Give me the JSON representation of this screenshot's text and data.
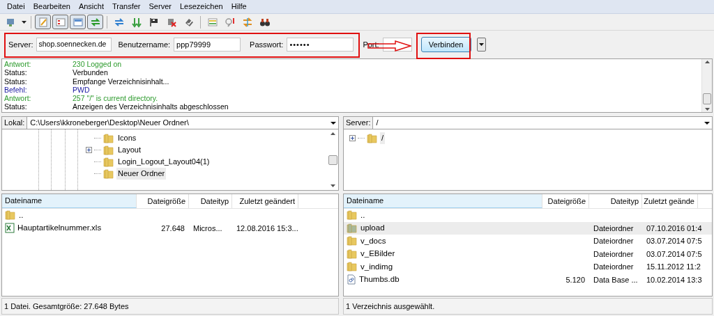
{
  "menu": [
    "Datei",
    "Bearbeiten",
    "Ansicht",
    "Transfer",
    "Server",
    "Lesezeichen",
    "Hilfe"
  ],
  "toolbar": [
    {
      "kind": "site",
      "pressed": false
    },
    {
      "kind": "log",
      "pressed": true
    },
    {
      "kind": "tree",
      "pressed": true
    },
    {
      "kind": "remote",
      "pressed": true
    },
    {
      "kind": "queue",
      "pressed": true
    },
    {
      "kind": "refresh",
      "pressed": false
    },
    {
      "kind": "process",
      "pressed": false
    },
    {
      "kind": "flag",
      "pressed": false
    },
    {
      "kind": "cancel",
      "pressed": false
    },
    {
      "kind": "disconnect",
      "pressed": false
    },
    {
      "kind": "filter",
      "pressed": false
    },
    {
      "kind": "compare",
      "pressed": false
    },
    {
      "kind": "sync",
      "pressed": false
    },
    {
      "kind": "find",
      "pressed": false
    }
  ],
  "quickconnect": {
    "server_label": "Server:",
    "server": "shop.soennecken.de",
    "user_label": "Benutzername:",
    "user": "ppp79999",
    "password_label": "Passwort:",
    "password": "••••••",
    "port_label": "Port:",
    "connect": "Verbinden"
  },
  "log": [
    {
      "kind": "response",
      "label": "Antwort:",
      "text": "230 Logged on"
    },
    {
      "kind": "status",
      "label": "Status:",
      "text": "Verbunden"
    },
    {
      "kind": "status",
      "label": "Status:",
      "text": "Empfange Verzeichnisinhalt..."
    },
    {
      "kind": "command",
      "label": "Befehl:",
      "text": "PWD"
    },
    {
      "kind": "response",
      "label": "Antwort:",
      "text": "257 \"/\" is current directory."
    },
    {
      "kind": "status",
      "label": "Status:",
      "text": "Anzeigen des Verzeichnisinhalts abgeschlossen"
    }
  ],
  "local": {
    "path_label": "Lokal:",
    "path": "C:\\Users\\kkroneberger\\Desktop\\Neuer Ordner\\",
    "tree": [
      {
        "label": "Icons",
        "has_children": false,
        "selected": false
      },
      {
        "label": "Layout",
        "has_children": true,
        "selected": false
      },
      {
        "label": "Login_Logout_Layout04(1)",
        "has_children": false,
        "selected": false
      },
      {
        "label": "Neuer Ordner",
        "has_children": false,
        "selected": true
      }
    ],
    "columns": [
      "Dateiname",
      "Dateigröße",
      "Dateityp",
      "Zuletzt geändert"
    ],
    "rows": [
      {
        "kind": "folder",
        "name": "..",
        "size": "",
        "type": "",
        "date": "",
        "selected": false
      },
      {
        "kind": "excel",
        "name": "Hauptartikelnummer.xls",
        "size": "27.648",
        "type": "Micros...",
        "date": "12.08.2016 15:3...",
        "selected": false
      }
    ],
    "status": "1 Datei. Gesamtgröße: 27.648 Bytes"
  },
  "remote": {
    "path_label": "Server:",
    "path": "/",
    "tree": [
      {
        "label": "/",
        "has_children": true,
        "selected": true
      }
    ],
    "columns": [
      "Dateiname",
      "Dateigröße",
      "Dateityp",
      "Zuletzt geände"
    ],
    "rows": [
      {
        "kind": "folder",
        "name": "..",
        "size": "",
        "type": "",
        "date": "",
        "selected": false
      },
      {
        "kind": "folder-grey",
        "name": "upload",
        "size": "",
        "type": "Dateiordner",
        "date": "07.10.2016 01:4",
        "selected": true
      },
      {
        "kind": "folder",
        "name": "v_docs",
        "size": "",
        "type": "Dateiordner",
        "date": "03.07.2014 07:5",
        "selected": false
      },
      {
        "kind": "folder",
        "name": "v_EBilder",
        "size": "",
        "type": "Dateiordner",
        "date": "03.07.2014 07:5",
        "selected": false
      },
      {
        "kind": "folder",
        "name": "v_indimg",
        "size": "",
        "type": "Dateiordner",
        "date": "15.11.2012 11:2",
        "selected": false
      },
      {
        "kind": "file",
        "name": "Thumbs.db",
        "size": "5.120",
        "type": "Data Base ...",
        "date": "10.02.2014 13:3",
        "selected": false
      }
    ],
    "status": "1 Verzeichnis ausgewählt."
  }
}
